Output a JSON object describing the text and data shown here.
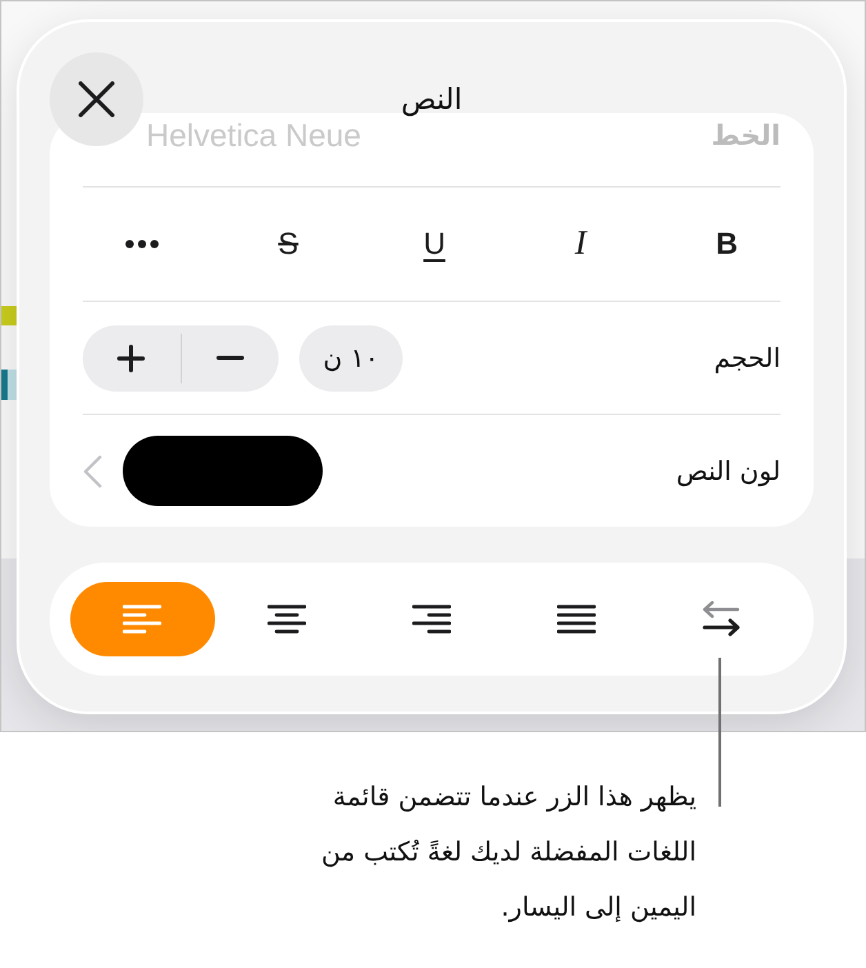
{
  "popover": {
    "title": "النص"
  },
  "font_row": {
    "label": "الخط",
    "value": "Helvetica Neue"
  },
  "styles": [
    {
      "kind": "bold",
      "label": "B"
    },
    {
      "kind": "italic",
      "label": "I"
    },
    {
      "kind": "underline",
      "label": "U"
    },
    {
      "kind": "strikethrough",
      "label": "S"
    },
    {
      "kind": "more"
    }
  ],
  "size_row": {
    "label": "الحجم",
    "value": "١٠ ن"
  },
  "color_row": {
    "label": "لون النص",
    "color": "#000000"
  },
  "alignment": [
    {
      "kind": "direction",
      "selected": false
    },
    {
      "kind": "justify",
      "selected": false
    },
    {
      "kind": "right",
      "selected": false
    },
    {
      "kind": "center",
      "selected": false
    },
    {
      "kind": "left",
      "selected": true
    }
  ],
  "callout": {
    "text": "يظهر هذا الزر عندما تتضمن قائمة\nاللغات المفضلة لديك لغةً تُكتب من\nاليمين إلى اليسار."
  }
}
